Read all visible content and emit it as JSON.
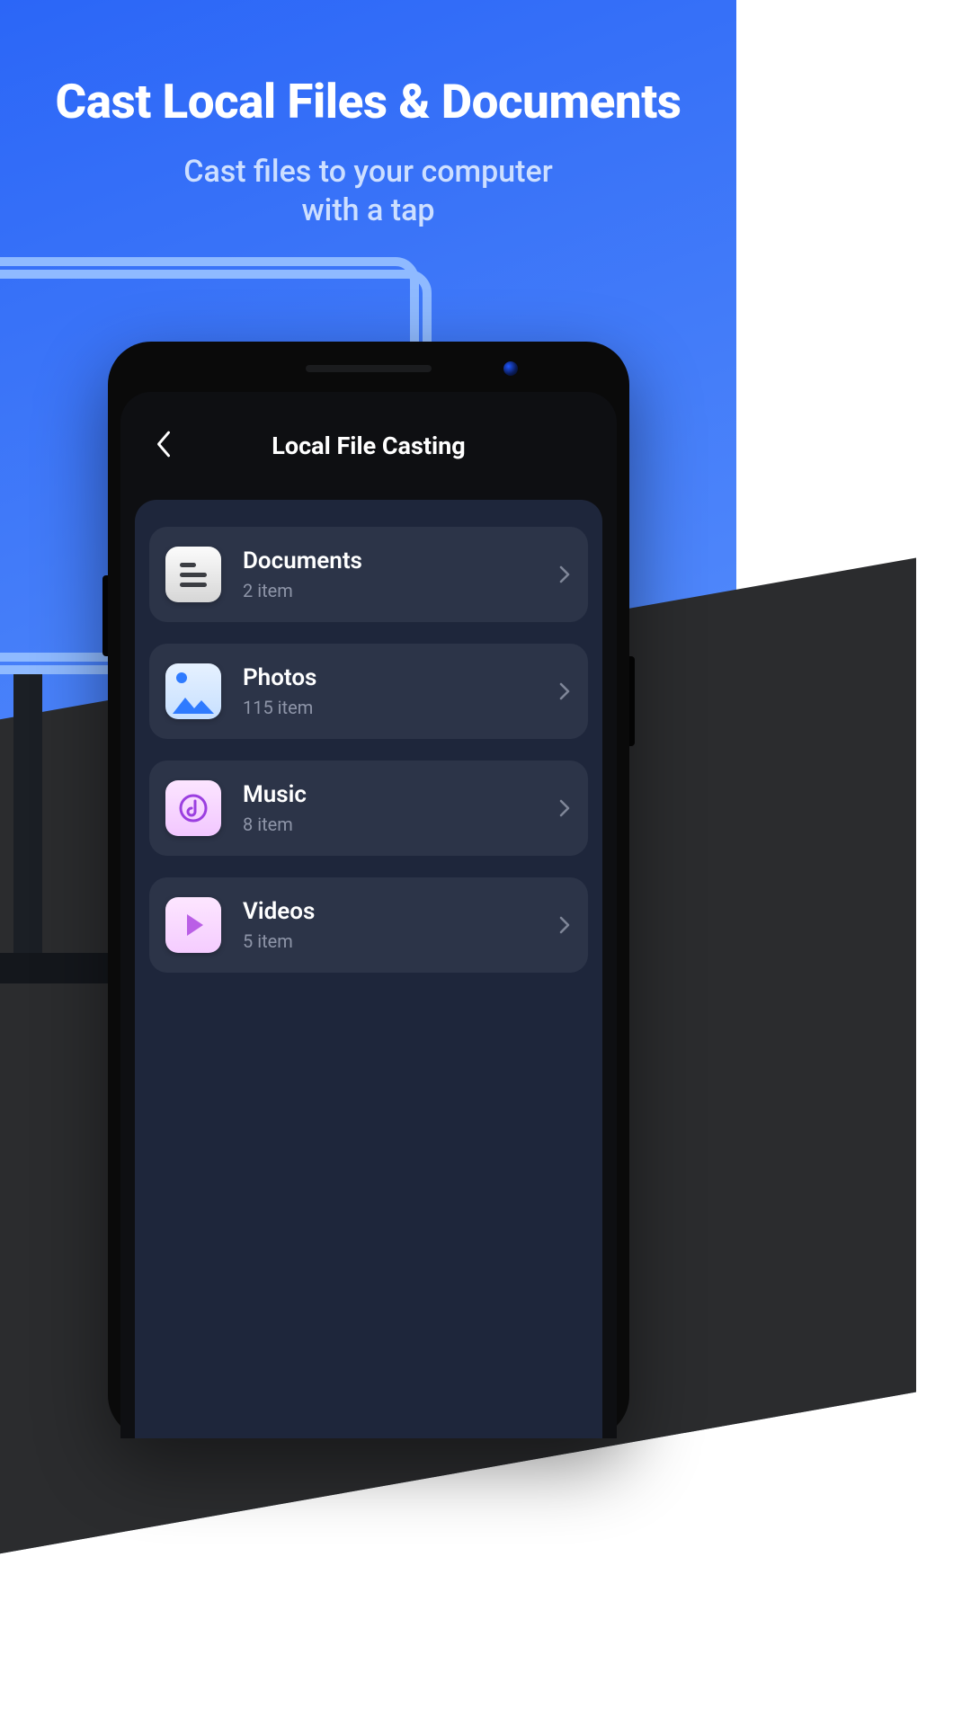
{
  "promo": {
    "headline": "Cast Local Files & Documents",
    "subhead_l1": "Cast files to your computer",
    "subhead_l2": "with a tap"
  },
  "app": {
    "screen_title": "Local File Casting",
    "rows": [
      {
        "name": "Documents",
        "sub": "2 item"
      },
      {
        "name": "Photos",
        "sub": "115 item"
      },
      {
        "name": "Music",
        "sub": "8 item"
      },
      {
        "name": "Videos",
        "sub": "5 item"
      }
    ]
  },
  "colors": {
    "accent_blue": "#3a72f6",
    "card_bg": "#2c3448",
    "screen_bg": "#1e263b"
  }
}
